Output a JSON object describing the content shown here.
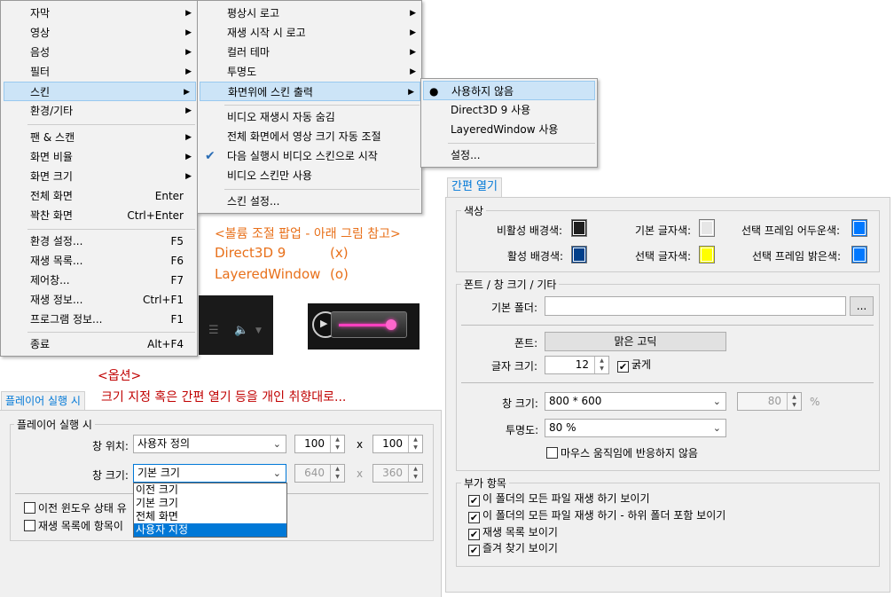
{
  "main_menu": {
    "items": [
      {
        "label": "자막",
        "shortcut": "",
        "submenu": true
      },
      {
        "label": "영상",
        "shortcut": "",
        "submenu": true
      },
      {
        "label": "음성",
        "shortcut": "",
        "submenu": true
      },
      {
        "label": "필터",
        "shortcut": "",
        "submenu": true
      },
      {
        "label": "스킨",
        "shortcut": "",
        "submenu": true
      },
      {
        "label": "환경/기타",
        "shortcut": "",
        "submenu": true
      },
      {
        "label": "팬 & 스캔",
        "shortcut": "",
        "submenu": true
      },
      {
        "label": "화면 비율",
        "shortcut": "",
        "submenu": true
      },
      {
        "label": "화면 크기",
        "shortcut": "",
        "submenu": true
      },
      {
        "label": "전체 화면",
        "shortcut": "Enter",
        "submenu": false
      },
      {
        "label": "꽉찬 화면",
        "shortcut": "Ctrl+Enter",
        "submenu": false
      },
      {
        "label": "환경 설정...",
        "shortcut": "F5",
        "submenu": false
      },
      {
        "label": "재생 목록...",
        "shortcut": "F6",
        "submenu": false
      },
      {
        "label": "제어창...",
        "shortcut": "F7",
        "submenu": false
      },
      {
        "label": "재생 정보...",
        "shortcut": "Ctrl+F1",
        "submenu": false
      },
      {
        "label": "프로그램 정보...",
        "shortcut": "F1",
        "submenu": false
      },
      {
        "label": "종료",
        "shortcut": "Alt+F4",
        "submenu": false
      }
    ]
  },
  "skin_menu": {
    "items": [
      {
        "label": "평상시 로고"
      },
      {
        "label": "재생 시작 시 로고"
      },
      {
        "label": "컬러 테마"
      },
      {
        "label": "투명도"
      },
      {
        "label": "화면위에 스킨 출력"
      },
      {
        "label": "비디오 재생시 자동 숨김"
      },
      {
        "label": "전체 화면에서 영상 크기 자동 조절"
      },
      {
        "label": "다음 실행시 비디오 스킨으로 시작"
      },
      {
        "label": "비디오 스킨만 사용"
      },
      {
        "label": "스킨 설정..."
      }
    ]
  },
  "overlay_menu": {
    "items": [
      {
        "label": "사용하지 않음"
      },
      {
        "label": "Direct3D 9 사용"
      },
      {
        "label": "LayeredWindow 사용"
      },
      {
        "label": "설정..."
      }
    ]
  },
  "notes": {
    "volume_popup": "<볼륨 조절 팝업 - 아래 그림 참고>",
    "d3d": "Direct3D 9",
    "d3d_mark": "(x)",
    "layered": "LayeredWindow",
    "layered_mark": "(o)",
    "options_title": "<옵션>",
    "options_desc": "크기 지정 혹은 간편 열기 등을 개인 취향대로..."
  },
  "player_dialog": {
    "tab": "플레이어 실행 시",
    "group": "플레이어 실행 시",
    "position_label": "창 위치:",
    "position_value": "사용자 정의",
    "pos_x": "100",
    "x_sep": "x",
    "pos_y": "100",
    "size_label": "창 크기:",
    "size_value": "기본 크기",
    "size_w": "640",
    "size_h": "360",
    "dropdown_options": [
      "이전 크기",
      "기본 크기",
      "전체 화면",
      "사용자 지정"
    ],
    "cb_prev_window": "이전 윈도우 상태 유",
    "cb_playlist": "재생 목록에 항목이"
  },
  "easy_open": {
    "tab": "간편 열기",
    "colors_group": "색상",
    "inactive_bg": "비활성 배경색:",
    "active_bg": "활성 배경색:",
    "default_text": "기본 글자색:",
    "selected_text": "선택 글자색:",
    "frame_dark": "선택 프레임 어두운색:",
    "frame_light": "선택 프레임 밝은색:",
    "swatch_inactive_bg": "#1e1e1e",
    "swatch_active_bg": "#003f8a",
    "swatch_default_text": "#e6e6e6",
    "swatch_selected_text": "#ffff00",
    "swatch_frame_dark": "#0078ff",
    "swatch_frame_light": "#0078ff",
    "font_group": "폰트 / 창 크기 / 기타",
    "folder_label": "기본 폴더:",
    "folder_value": "",
    "browse": "...",
    "font_label": "폰트:",
    "font_button": "맑은 고딕",
    "fontsize_label": "글자 크기:",
    "fontsize_value": "12",
    "bold_label": "굵게",
    "winsize_label": "창 크기:",
    "winsize_value": "800 * 600",
    "winsize_pct": "80",
    "pct_sign": "%",
    "opacity_label": "투명도:",
    "opacity_value": "80 %",
    "mouse_ignore": "마우스 움직임에 반응하지 않음",
    "extra_group": "부가 항목",
    "extra_items": [
      "이 폴더의 모든 파일 재생 하기 보이기",
      "이 폴더의 모든 파일 재생 하기 - 하위 폴더 포함 보이기",
      "재생 목록 보이기",
      "즐겨 찾기 보이기"
    ]
  }
}
